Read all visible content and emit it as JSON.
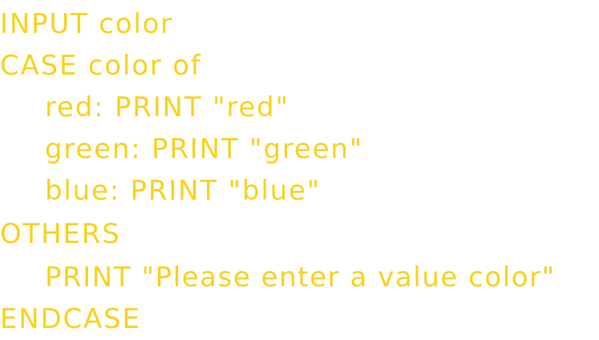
{
  "code": {
    "lines": [
      "INPUT color",
      "CASE color of",
      "red: PRINT \"red\"",
      "green: PRINT \"green\"",
      "blue: PRINT \"blue\"",
      "OTHERS",
      "PRINT \"Please enter a value color\"",
      "ENDCASE"
    ],
    "text_color": "#f7d21e",
    "background_color": "#ffffff"
  }
}
